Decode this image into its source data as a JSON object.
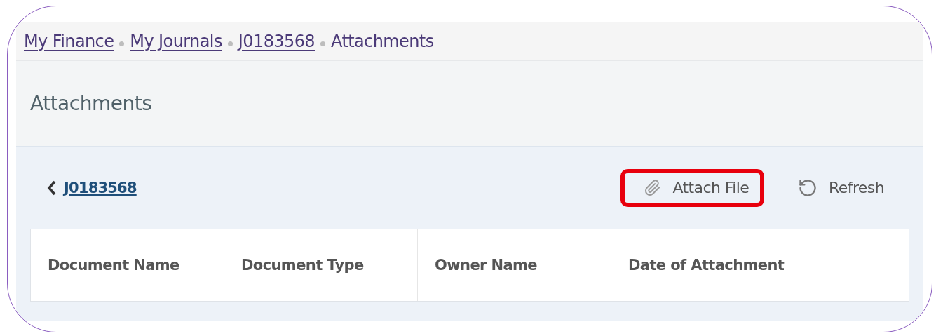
{
  "breadcrumb": [
    {
      "label": "My Finance",
      "link": true
    },
    {
      "label": "My Journals",
      "link": true
    },
    {
      "label": "J0183568",
      "link": true
    },
    {
      "label": "Attachments",
      "link": false
    }
  ],
  "page_title": "Attachments",
  "back_link": "J0183568",
  "actions": [
    {
      "kind": "attach",
      "label": "Attach File",
      "highlighted": true
    },
    {
      "kind": "refresh",
      "label": "Refresh",
      "highlighted": false
    }
  ],
  "table": {
    "columns": [
      "Document Name",
      "Document Type",
      "Owner Name",
      "Date of Attachment"
    ]
  }
}
